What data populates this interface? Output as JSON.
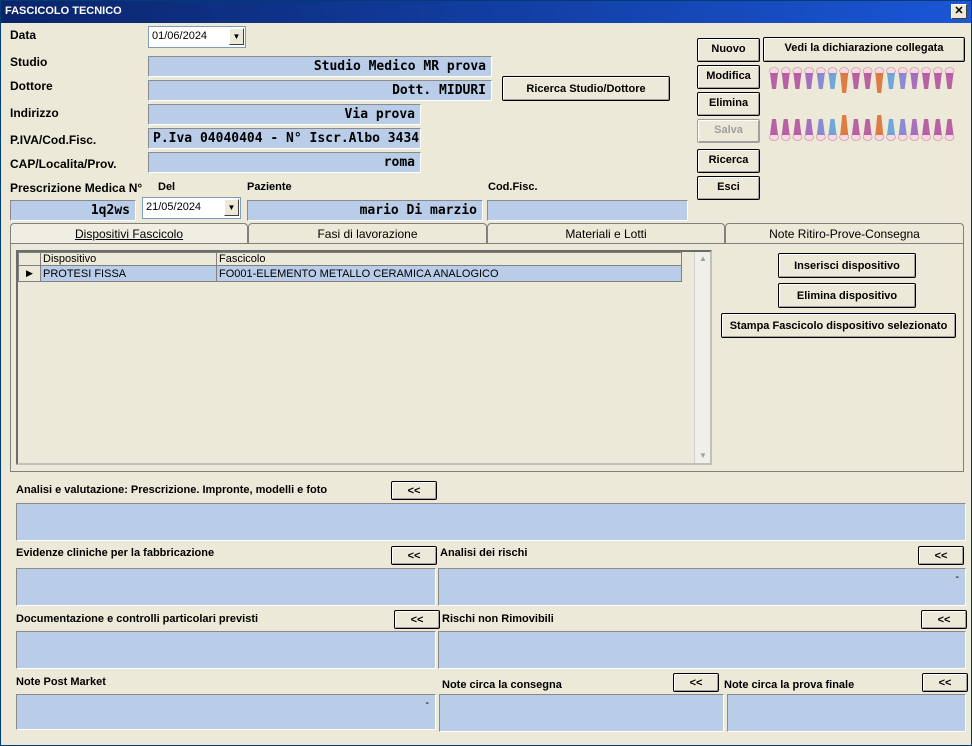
{
  "window": {
    "title": "FASCICOLO TECNICO",
    "close_glyph": "✕"
  },
  "header": {
    "data_label": "Data",
    "data_value": "01/06/2024",
    "studio_label": "Studio",
    "studio_value": "Studio Medico MR prova",
    "dottore_label": "Dottore",
    "dottore_value": "Dott. MIDURI",
    "indirizzo_label": "Indirizzo",
    "indirizzo_value": "Via prova",
    "piva_label": "P.IVA/Cod.Fisc.",
    "piva_value": "P.Iva 04040404 - N° Iscr.Albo 3434",
    "cap_label": "CAP/Localita/Prov.",
    "cap_value": "roma",
    "ricerca_studio_button": "Ricerca Studio/Dottore"
  },
  "prescription": {
    "presc_label": "Prescrizione Medica N°",
    "presc_value": "1q2ws",
    "del_label": "Del",
    "del_value": "21/05/2024",
    "paziente_label": "Paziente",
    "paziente_value": "mario Di marzio",
    "codfisc_label": "Cod.Fisc.",
    "codfisc_value": ""
  },
  "actions": {
    "nuovo": "Nuovo",
    "vedi_dichiarazione": "Vedi la dichiarazione collegata",
    "modifica": "Modifica",
    "elimina": "Elimina",
    "salva": "Salva",
    "ricerca": "Ricerca",
    "esci": "Esci"
  },
  "tabs": [
    {
      "label": "Dispositivi Fascicolo"
    },
    {
      "label": "Fasi di lavorazione"
    },
    {
      "label": "Materiali e Lotti"
    },
    {
      "label": "Note Ritiro-Prove-Consegna"
    }
  ],
  "grid": {
    "columns": [
      "Dispositivo",
      "Fascicolo"
    ],
    "rows": [
      {
        "dispositivo": "PROTESI FISSA",
        "fascicolo": "FO001-ELEMENTO METALLO CERAMICA ANALOGICO"
      }
    ],
    "row_indicator": "▶"
  },
  "grid_actions": {
    "inserisci": "Inserisci dispositivo",
    "elimina": "Elimina dispositivo",
    "stampa": "Stampa Fascicolo dispositivo selezionato"
  },
  "sections": {
    "analisi_label": "Analisi e valutazione: Prescrizione. Impronte, modelli e foto",
    "evidenze_label": "Evidenze cliniche per la fabbricazione",
    "analisi_rischi_label": "Analisi dei rischi",
    "analisi_rischi_value": "-",
    "documentazione_label": "Documentazione e controlli particolari previsti",
    "rischi_label": "Rischi non Rimovibili",
    "post_market_label": "Note Post Market",
    "post_market_value": "-",
    "consegna_label": "Note circa la consegna",
    "prova_finale_label": "Note circa la prova finale",
    "expand_glyph": "<<"
  },
  "icons": {
    "teeth": "dental-chart-icon",
    "combo_arrow": "dropdown-arrow-icon",
    "scroll_up": "▲",
    "scroll_down": "▼"
  },
  "colors": {
    "field_bg": "#b9cde8",
    "window_bg": "#ece9d8",
    "titlebar": "#0a246a"
  }
}
